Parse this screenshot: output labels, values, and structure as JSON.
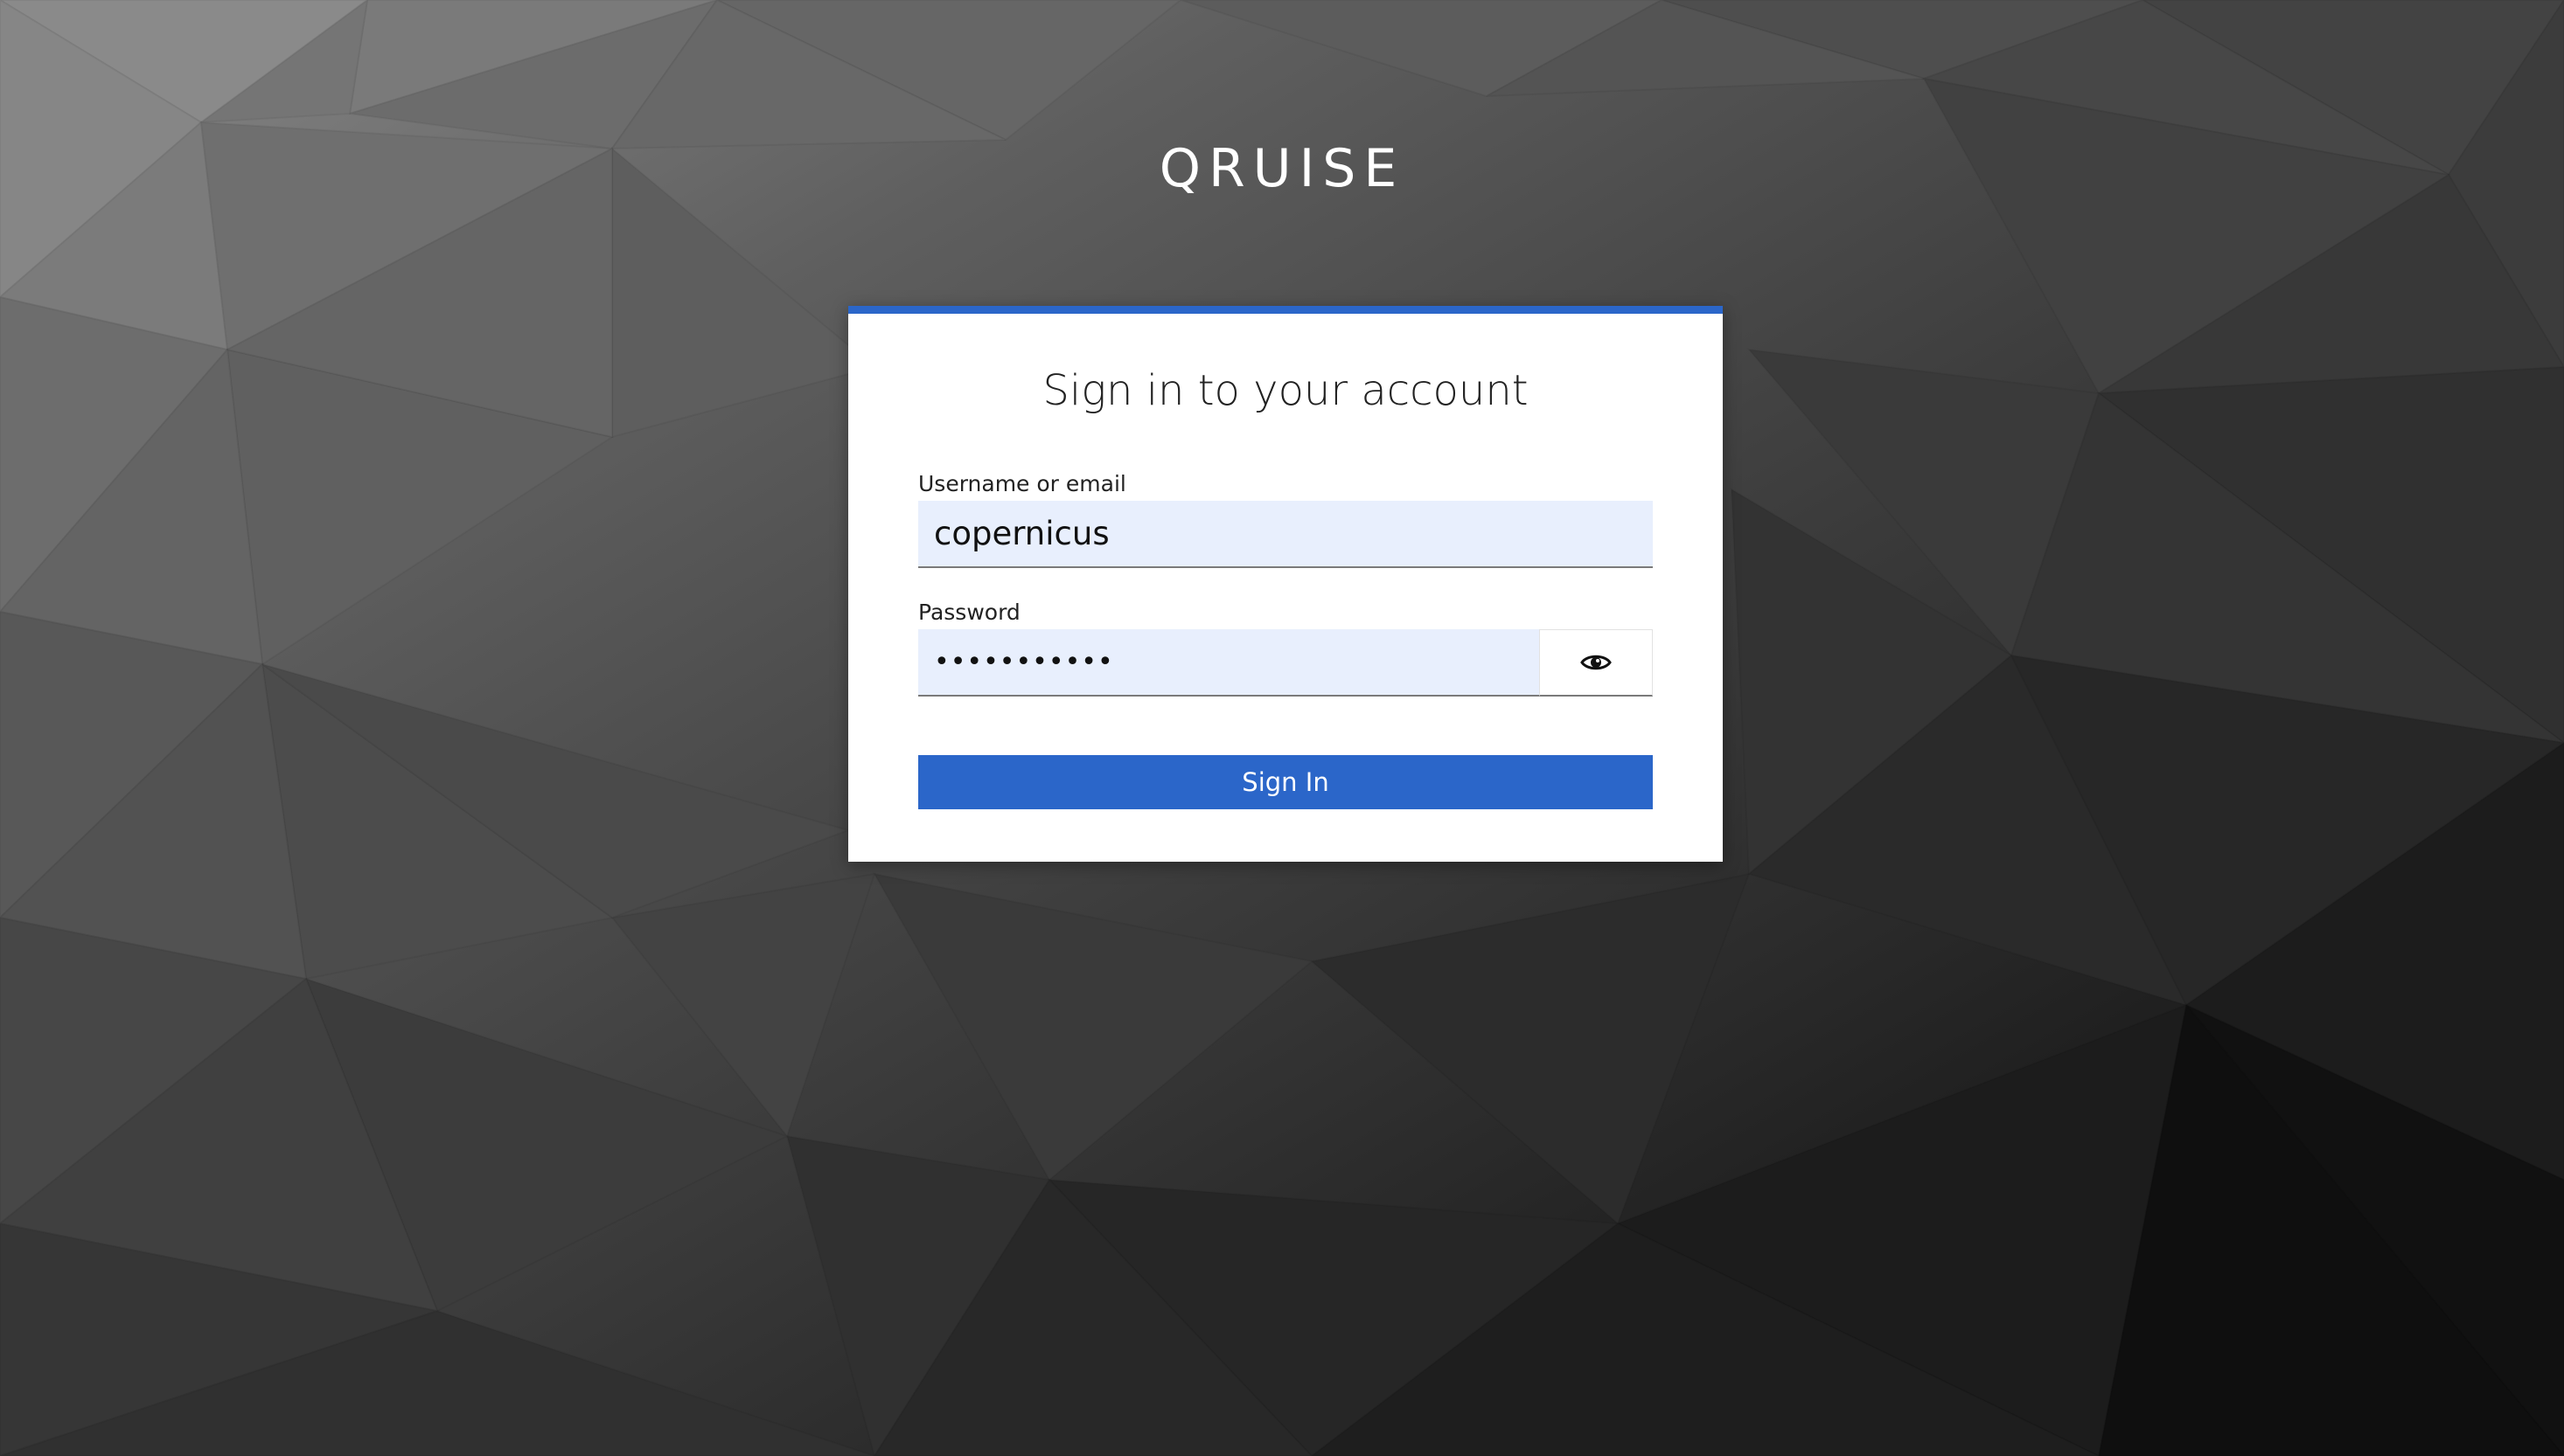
{
  "brand": {
    "name": "QRUISE"
  },
  "login": {
    "title": "Sign in to your account",
    "username": {
      "label": "Username or email",
      "value": "copernicus"
    },
    "password": {
      "label": "Password",
      "masked_value": "•••••••••••",
      "toggle_icon": "eye-icon"
    },
    "submit_label": "Sign In"
  },
  "colors": {
    "accent": "#2b66c9",
    "input_background": "#e8effd",
    "card_background": "#ffffff"
  }
}
